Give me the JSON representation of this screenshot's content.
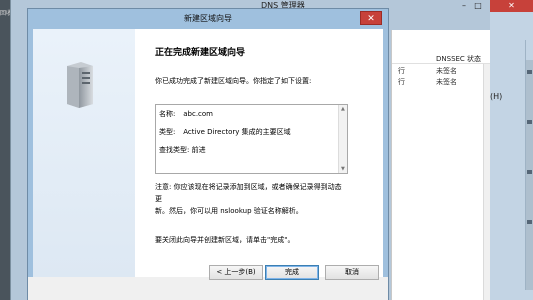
{
  "background_app": {
    "title": "DNS 管理器",
    "left_strip_text": "回收",
    "columns": {
      "dnssec_header": "DNSSEC 状态"
    },
    "rows": [
      {
        "col1": "行",
        "dnssec": "未签名"
      },
      {
        "col1": "行",
        "dnssec": "未签名"
      }
    ],
    "right_panel_label": "(H)",
    "close_glyph": "✕",
    "minimize_glyph": "–",
    "maximize_glyph": "□"
  },
  "wizard": {
    "title": "新建区域向导",
    "close_glyph": "✕",
    "heading": "正在完成新建区域向导",
    "intro": "你已成功完成了新建区域向导。你指定了如下设置:",
    "summary": [
      {
        "label": "名称:",
        "value": "abc.com"
      },
      {
        "label": "类型:",
        "value": "Active Directory 集成的主要区域"
      },
      {
        "label": "查找类型:",
        "value": "前进"
      }
    ],
    "note_lines": [
      "注意: 你应该现在将记录添加到区域，或者确保记录得到动态更",
      "新。然后，你可以用 nslookup 验证名称解析。"
    ],
    "footer_text": "要关闭此向导并创建新区域，请单击\"完成\"。",
    "buttons": {
      "back": "< 上一步(B)",
      "finish": "完成",
      "cancel": "取消"
    },
    "icon": "server-icon"
  }
}
